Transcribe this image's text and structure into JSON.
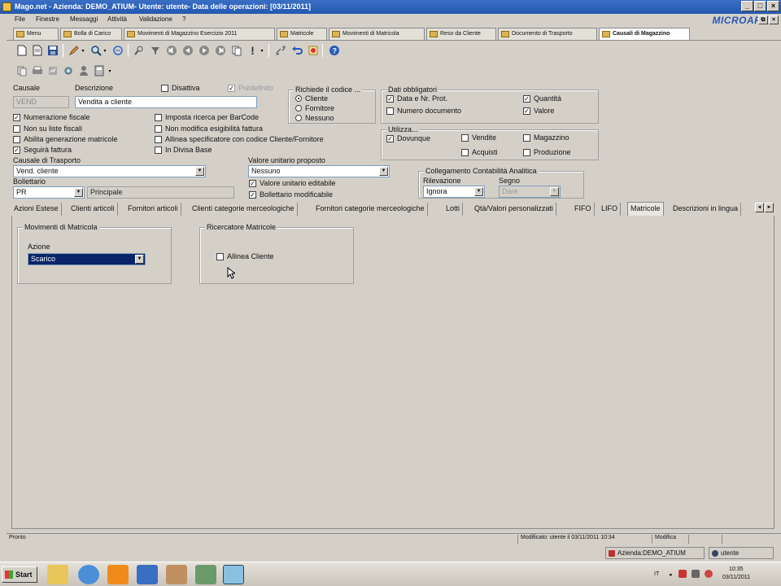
{
  "window": {
    "title": "Mago.net - Azienda: DEMO_ATIUM- Utente: utente- Data delle operazioni: [03/11/2011]",
    "minimize": "_",
    "maximize": "□",
    "close": "×",
    "child_restore": "⧉",
    "child_close": "×"
  },
  "menu": {
    "items": [
      "File",
      "Finestre",
      "Messaggi",
      "Attività",
      "Validazione",
      "?"
    ],
    "brand": "MICROAREA"
  },
  "doc_tabs": [
    "Menu",
    "Bolla di Carico",
    "Movimenti di Magazzino Esercizio 2011",
    "Matricole",
    "Movimenti di Matricola",
    "Reso da Cliente",
    "Documento di Trasporto",
    "Causali di Magazzino"
  ],
  "form": {
    "causale": {
      "label": "Causale",
      "value": "VEND"
    },
    "descrizione": {
      "label": "Descrizione",
      "value": "Vendita a cliente"
    },
    "disattiva": {
      "label": "Disattiva",
      "checked": false
    },
    "predefinito": {
      "label": "Predefinito",
      "checked": true
    },
    "richiede": {
      "title": "Richiede il codice ...",
      "options": [
        "Cliente",
        "Fornitore",
        "Nessuno"
      ],
      "selected": "Cliente"
    },
    "dati_obbligatori": {
      "title": "Dati obbligatori",
      "items": [
        {
          "label": "Data e Nr. Prot.",
          "checked": true
        },
        {
          "label": "Numero documento",
          "checked": false
        },
        {
          "label": "Quantità",
          "checked": true
        },
        {
          "label": "Valore",
          "checked": true
        }
      ]
    },
    "checks_left": [
      {
        "label": "Numerazione fiscale",
        "checked": true
      },
      {
        "label": "Non su liste fiscali",
        "checked": false
      },
      {
        "label": "Abilita generazione matricole",
        "checked": false
      },
      {
        "label": "Seguirà fattura",
        "checked": true
      }
    ],
    "checks_mid": [
      {
        "label": "Imposta ricerca per BarCode",
        "checked": false
      },
      {
        "label": "Non modifica esigibilità fattura",
        "checked": false
      },
      {
        "label": "Allinea specificatore con codice Cliente/Fornitore",
        "checked": false
      },
      {
        "label": "In Divisa Base",
        "checked": false
      }
    ],
    "utilizza": {
      "title": "Utilizza...",
      "items": [
        {
          "label": "Dovunque",
          "checked": true
        },
        {
          "label": "Vendite",
          "checked": false
        },
        {
          "label": "Magazzino",
          "checked": false
        },
        {
          "label": "Acquisti",
          "checked": false
        },
        {
          "label": "Produzione",
          "checked": false
        }
      ]
    },
    "causale_trasporto": {
      "label": "Causale di Trasporto",
      "value": "Vend. cliente"
    },
    "valore_unitario": {
      "label": "Valore unitario proposto",
      "value": "Nessuno"
    },
    "valore_editabile": {
      "label": "Valore unitario editabile",
      "checked": true
    },
    "bollettario_mod": {
      "label": "Bollettario modificabile",
      "checked": true
    },
    "bollettario": {
      "label": "Bollettario",
      "value": "PR",
      "desc": "Principale"
    },
    "coll_analitica": {
      "title": "Collegamento Contabilità Analitica",
      "rilevazione_label": "Rilevazione",
      "rilevazione_value": "Ignora",
      "segno_label": "Segno",
      "segno_value": "Dare"
    }
  },
  "sub_tabs": [
    "Azioni Estese",
    "Clienti articoli",
    "Fornitori articoli",
    "Clienti categorie merceologiche",
    "Fornitori categorie merceologiche",
    "Lotti",
    "Qtà/Valori personalizzati",
    "FIFO",
    "LIFO",
    "Matricole",
    "Descrizioni in lingua"
  ],
  "active_sub_tab": "Matricole",
  "matricole_tab": {
    "movimenti": {
      "title": "Movimenti di Matricola",
      "azione_label": "Azione",
      "azione_value": "Scarico"
    },
    "ricercatore": {
      "title": "Ricercatore Matricole",
      "allinea_label": "Allinea Cliente",
      "checked": false
    }
  },
  "status": {
    "left": "Pronto",
    "modified": "Modificato: utente il 03/11/2011 10:34",
    "mode": "Modifica"
  },
  "info": {
    "azienda": "Azienda:DEMO_ATIUM",
    "utente": "utente"
  },
  "taskbar": {
    "start": "Start",
    "lang": "IT",
    "time": "10:35",
    "date": "03/11/2011"
  },
  "checkmark": "✓",
  "arrow": "▼",
  "scroll_left": "◄",
  "scroll_right": "►"
}
